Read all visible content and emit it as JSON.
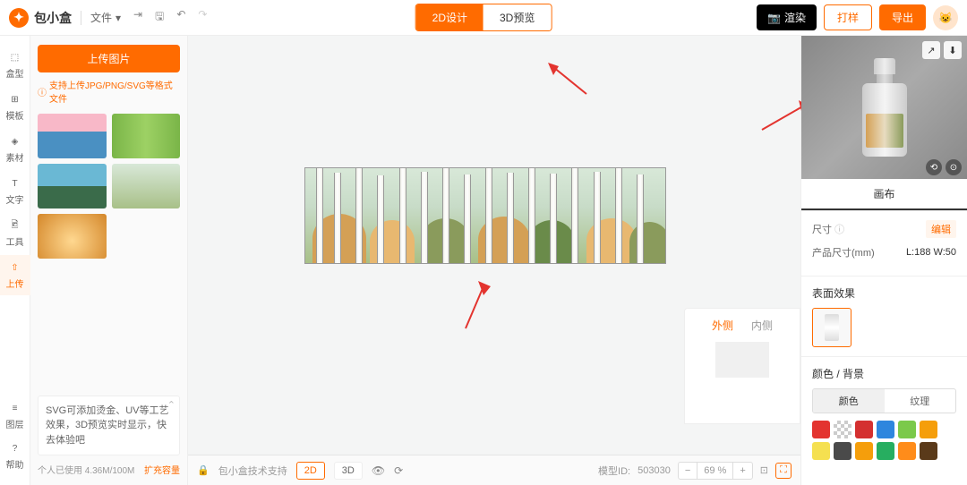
{
  "brand": "包小盒",
  "file_menu": "文件",
  "view_tabs": {
    "design2d": "2D设计",
    "preview3d": "3D预览"
  },
  "top_buttons": {
    "render": "渲染",
    "sample": "打样",
    "export": "导出"
  },
  "rail": [
    {
      "icon": "⬚",
      "label": "盒型"
    },
    {
      "icon": "⊞",
      "label": "模板"
    },
    {
      "icon": "◈",
      "label": "素材"
    },
    {
      "icon": "T",
      "label": "文字"
    },
    {
      "icon": "🖻",
      "label": "工具"
    },
    {
      "icon": "⇧",
      "label": "上传"
    }
  ],
  "rail_bottom": [
    {
      "icon": "≡",
      "label": "图层"
    },
    {
      "icon": "?",
      "label": "帮助"
    }
  ],
  "upload": {
    "button": "上传图片",
    "hint": "支持上传JPG/PNG/SVG等格式文件"
  },
  "svg_hint": "SVG可添加烫金、UV等工艺效果，3D预览实时显示，快去体验吧",
  "storage": {
    "used": "个人已使用 4.36M/100M",
    "expand": "扩充容量"
  },
  "bottom_bar": {
    "tech": "包小盒技术支持",
    "tab2d": "2D",
    "tab3d": "3D",
    "model_id_label": "模型ID:",
    "model_id": "503030",
    "zoom": "69 %"
  },
  "side_panel": {
    "outer": "外侧",
    "inner": "内侧"
  },
  "right_panel": {
    "tab_canvas": "画布",
    "size_label": "尺寸",
    "edit": "编辑",
    "product_size_label": "产品尺寸(mm)",
    "product_size": "L:188  W:50",
    "surface_title": "表面效果",
    "color_title": "颜色 / 背景",
    "color_tab": "颜色",
    "texture_tab": "纹理"
  },
  "swatches": [
    "#e3342f",
    "checker",
    "#d43030",
    "#2e86de",
    "#7bc94a",
    "#f59e0b",
    "#f5e050",
    "#4a4a4a",
    "#f59e0b",
    "#27ae60",
    "#ff8c1a",
    "#5a3a1a"
  ]
}
